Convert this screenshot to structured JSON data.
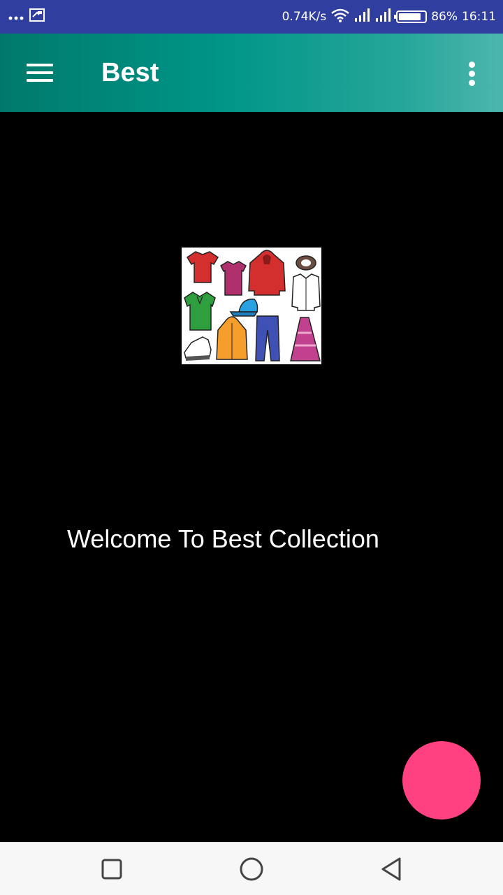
{
  "status_bar": {
    "left_icons": [
      "more-dots-icon",
      "cast-icon"
    ],
    "network_speed": "0.74K/s",
    "signal_icons": [
      "wifi-icon",
      "signal-icon",
      "signal-icon"
    ],
    "battery_percent": "86%",
    "battery_level": 0.86,
    "time": "16:11"
  },
  "app_bar": {
    "title": "Best",
    "menu_icon": "hamburger-menu-icon",
    "overflow_icon": "more-vert-icon",
    "colors": {
      "start": "#00796B",
      "end": "#4DB6AC"
    }
  },
  "main": {
    "logo_image": "clothing-collection-image",
    "welcome_text": "Welcome To Best Collection"
  },
  "fab": {
    "icon": "none",
    "color": "#FF4081"
  },
  "nav_bar": {
    "buttons": [
      "recent-apps-icon",
      "home-icon",
      "back-icon"
    ]
  }
}
